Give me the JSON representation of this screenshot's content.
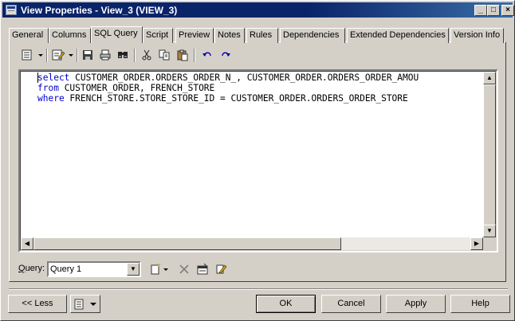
{
  "window": {
    "title": "View Properties - View_3 (VIEW_3)"
  },
  "titlebar_buttons": {
    "minimize": "_",
    "maximize": "□",
    "close": "×"
  },
  "tabs": [
    {
      "label": "General"
    },
    {
      "label": "Columns"
    },
    {
      "label": "SQL Query",
      "active": true
    },
    {
      "label": "Script"
    },
    {
      "label": "Preview"
    },
    {
      "label": "Notes"
    },
    {
      "label": "Rules"
    },
    {
      "label": "Dependencies"
    },
    {
      "label": "Extended Dependencies"
    },
    {
      "label": "Version Info"
    }
  ],
  "toolbar_icons": [
    "properties-menu-icon",
    "edit-menu-icon",
    "save-icon",
    "print-icon",
    "find-icon",
    "cut-icon",
    "copy-icon",
    "paste-icon",
    "undo-icon",
    "redo-icon"
  ],
  "editor": {
    "lines": [
      {
        "keyword": "select",
        "rest": " CUSTOMER_ORDER.ORDERS_ORDER_N_, CUSTOMER_ORDER.ORDERS_ORDER_AMOU"
      },
      {
        "keyword": "from",
        "rest": " CUSTOMER_ORDER, FRENCH_STORE"
      },
      {
        "keyword": "where",
        "rest": " FRENCH_STORE.STORE_STORE_ID = CUSTOMER_ORDER.ORDERS_ORDER_STORE"
      }
    ]
  },
  "query": {
    "label_accel": "Q",
    "label_rest": "uery:",
    "selected": "Query 1"
  },
  "buttons": {
    "less": "<< Less",
    "ok": "OK",
    "cancel": "Cancel",
    "apply": "Apply",
    "help": "Help"
  },
  "colors": {
    "titlebar": "#0a246a",
    "keyword": "#0000cc",
    "face": "#d4d0c8"
  }
}
